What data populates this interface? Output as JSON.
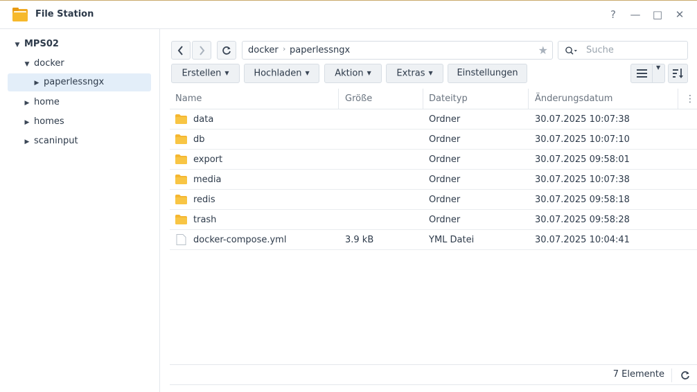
{
  "window": {
    "title": "File Station",
    "controls": {
      "help": "?",
      "minimize": "—",
      "maximize": "□",
      "close": "✕"
    }
  },
  "sidebar": {
    "root": "MPS02",
    "items": [
      {
        "label": "docker",
        "expanded": true,
        "level": 1
      },
      {
        "label": "paperlessngx",
        "expanded": false,
        "level": 2,
        "selected": true
      },
      {
        "label": "home",
        "expanded": false,
        "level": 1
      },
      {
        "label": "homes",
        "expanded": false,
        "level": 1
      },
      {
        "label": "scaninput",
        "expanded": false,
        "level": 1
      }
    ]
  },
  "path": {
    "segments": [
      "docker",
      "paperlessngx"
    ]
  },
  "search": {
    "placeholder": "Suche"
  },
  "toolbar": {
    "create": "Erstellen",
    "upload": "Hochladen",
    "action": "Aktion",
    "tools": "Extras",
    "settings": "Einstellungen"
  },
  "table": {
    "columns": [
      "Name",
      "Größe",
      "Dateityp",
      "Änderungsdatum"
    ],
    "rows": [
      {
        "name": "data",
        "size": "",
        "type": "Ordner",
        "modified": "30.07.2025 10:07:38",
        "icon": "folder-icon"
      },
      {
        "name": "db",
        "size": "",
        "type": "Ordner",
        "modified": "30.07.2025 10:07:10",
        "icon": "folder-icon"
      },
      {
        "name": "export",
        "size": "",
        "type": "Ordner",
        "modified": "30.07.2025 09:58:01",
        "icon": "folder-icon"
      },
      {
        "name": "media",
        "size": "",
        "type": "Ordner",
        "modified": "30.07.2025 10:07:38",
        "icon": "folder-icon"
      },
      {
        "name": "redis",
        "size": "",
        "type": "Ordner",
        "modified": "30.07.2025 09:58:18",
        "icon": "folder-icon"
      },
      {
        "name": "trash",
        "size": "",
        "type": "Ordner",
        "modified": "30.07.2025 09:58:28",
        "icon": "folder-icon"
      },
      {
        "name": "docker-compose.yml",
        "size": "3.9 kB",
        "type": "YML Datei",
        "modified": "30.07.2025 10:04:41",
        "icon": "file-icon"
      }
    ]
  },
  "status": {
    "count": "7 Elemente"
  },
  "colors": {
    "folder": "#f5b731",
    "selected": "#e3eef9",
    "accent_border": "#c9a96a"
  }
}
